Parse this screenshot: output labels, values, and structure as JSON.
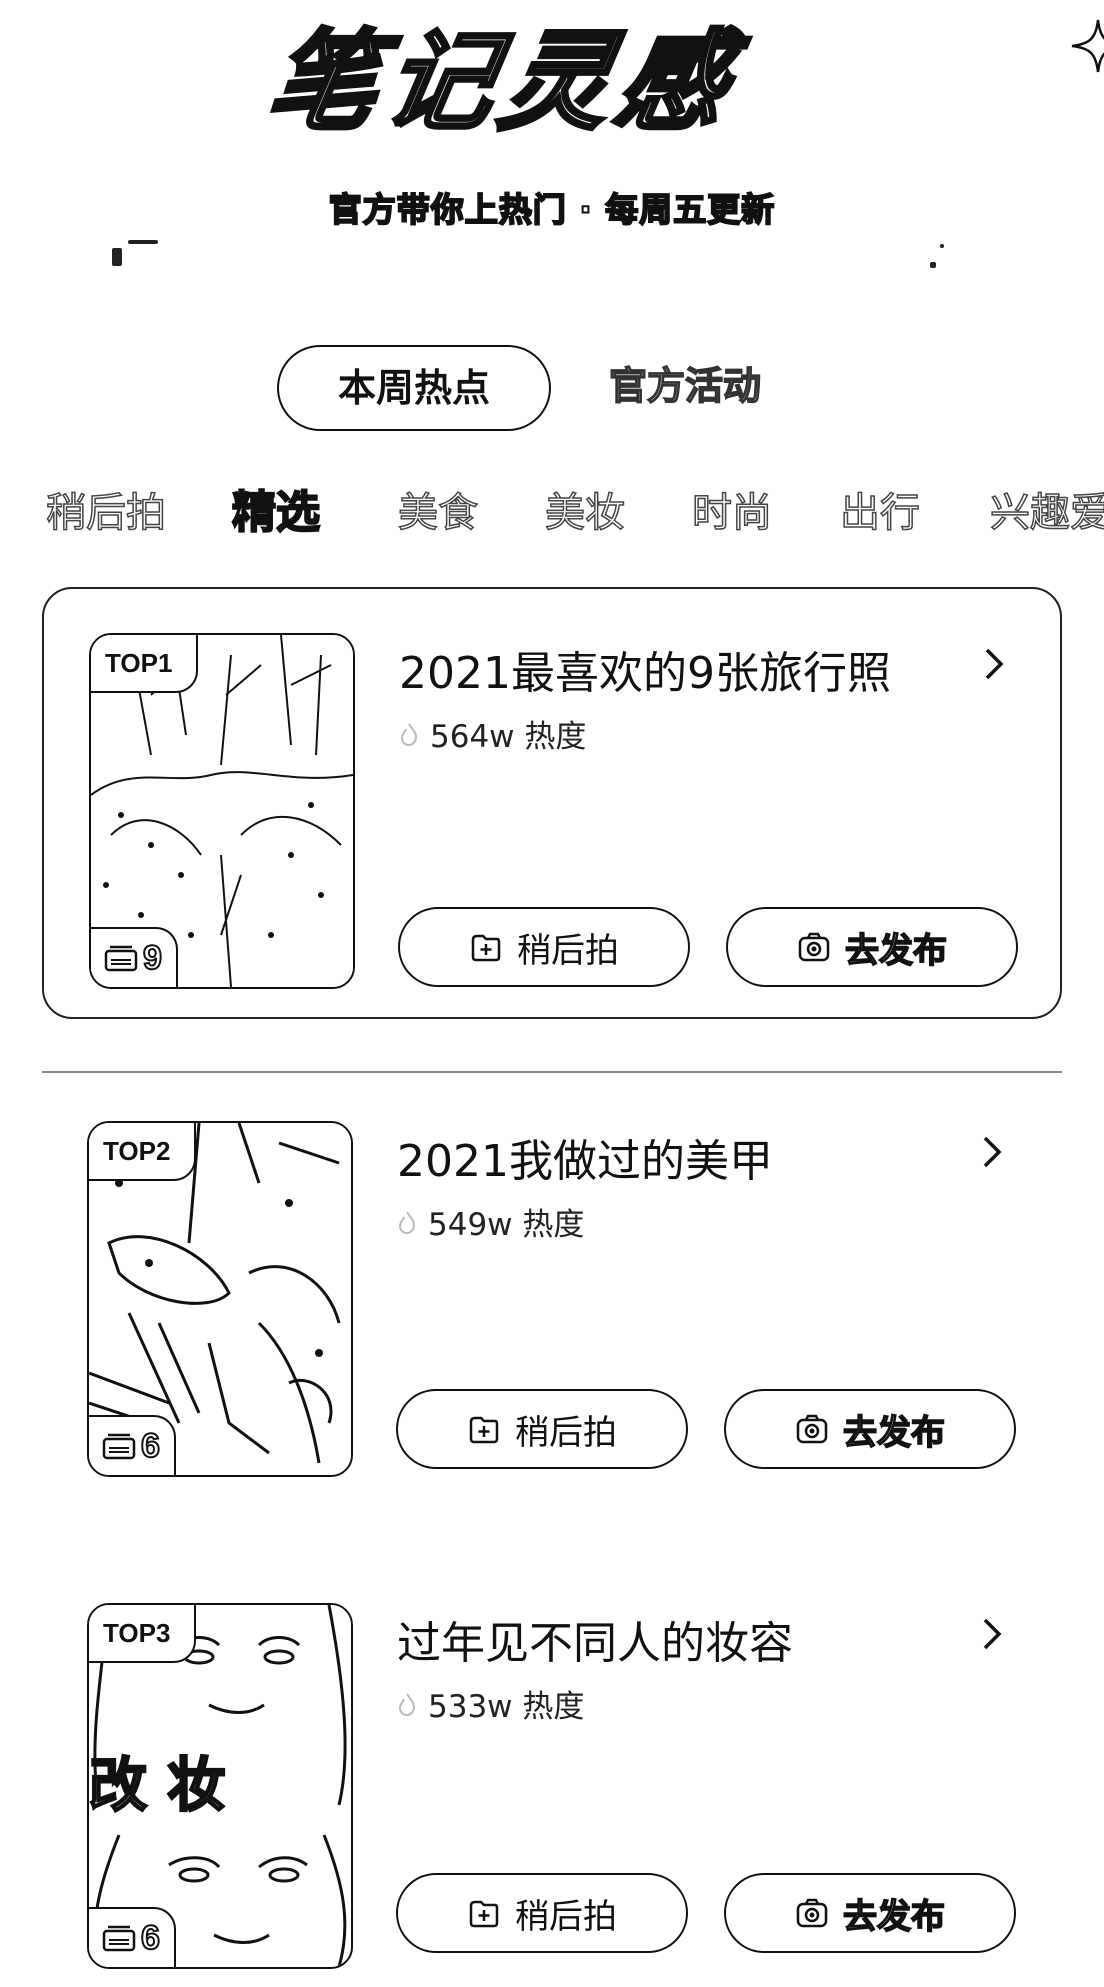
{
  "header": {
    "title": "笔记灵感",
    "subtitle": "官方带你上热门 · 每周五更新"
  },
  "main_tabs": [
    {
      "label": "本周热点",
      "active": true
    },
    {
      "label": "官方活动",
      "active": false
    }
  ],
  "categories": [
    {
      "label": "稍后拍",
      "active": false
    },
    {
      "label": "精选",
      "active": true
    },
    {
      "label": "美食",
      "active": false
    },
    {
      "label": "美妆",
      "active": false
    },
    {
      "label": "时尚",
      "active": false
    },
    {
      "label": "出行",
      "active": false
    },
    {
      "label": "兴趣爱",
      "active": false
    }
  ],
  "cards": [
    {
      "rank": "TOP1",
      "title": "2021最喜欢的9张旅行照",
      "heat": "564w 热度",
      "count": "9",
      "later_label": "稍后拍",
      "publish_label": "去发布"
    },
    {
      "rank": "TOP2",
      "title": "2021我做过的美甲",
      "heat": "549w 热度",
      "count": "6",
      "later_label": "稍后拍",
      "publish_label": "去发布"
    },
    {
      "rank": "TOP3",
      "title": "过年见不同人的妆容",
      "heat": "533w 热度",
      "count": "6",
      "thumb_text": "改 妆",
      "later_label": "稍后拍",
      "publish_label": "去发布"
    }
  ],
  "icons": {
    "sparkle": "sparkle-icon",
    "flame": "flame-icon",
    "chevron": "chevron-right-icon",
    "album": "album-icon",
    "add": "add-box-icon",
    "camera": "camera-icon"
  }
}
